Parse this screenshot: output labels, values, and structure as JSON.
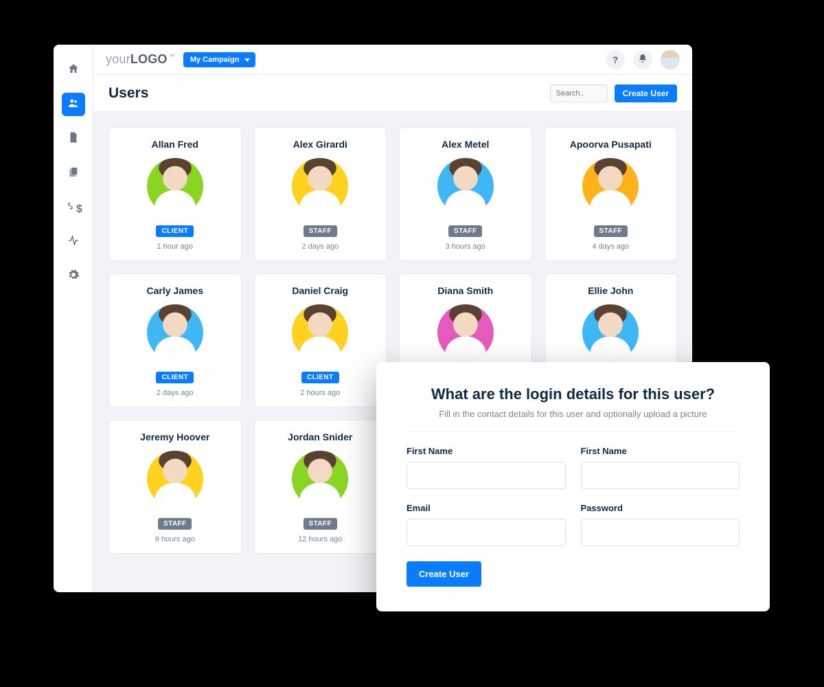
{
  "brand": {
    "prefix": "your",
    "main": "LOGO",
    "tm": "™"
  },
  "campaign_label": "My Campaign",
  "page_title": "Users",
  "search_placeholder": "Search..",
  "create_user_button": "Create User",
  "nav": {
    "home": "home",
    "users": "users",
    "report": "report",
    "files": "files",
    "billing": "billing",
    "activity": "activity",
    "settings": "settings"
  },
  "role_labels": {
    "client": "CLIENT",
    "staff": "STAFF"
  },
  "avatar_colors": {
    "green": "#8ad423",
    "yellow": "#ffd21f",
    "blue": "#3fb7f4",
    "orange": "#ffb21a",
    "pink": "#e45bbd"
  },
  "users": [
    {
      "name": "Allan Fred",
      "role": "client",
      "time": "1 hour ago",
      "color": "green"
    },
    {
      "name": "Alex Girardi",
      "role": "staff",
      "time": "2 days ago",
      "color": "yellow"
    },
    {
      "name": "Alex Metel",
      "role": "staff",
      "time": "3 hours ago",
      "color": "blue"
    },
    {
      "name": "Apoorva Pusapati",
      "role": "staff",
      "time": "4 days ago",
      "color": "orange"
    },
    {
      "name": "Carly James",
      "role": "client",
      "time": "2 days ago",
      "color": "blue"
    },
    {
      "name": "Daniel Craig",
      "role": "client",
      "time": "2 hours ago",
      "color": "yellow"
    },
    {
      "name": "Diana Smith",
      "role": "",
      "time": "",
      "color": "pink"
    },
    {
      "name": "Ellie John",
      "role": "",
      "time": "",
      "color": "blue"
    },
    {
      "name": "Jeremy Hoover",
      "role": "staff",
      "time": "9 hours ago",
      "color": "yellow"
    },
    {
      "name": "Jordan Snider",
      "role": "staff",
      "time": "12 hours ago",
      "color": "green"
    }
  ],
  "modal": {
    "title": "What are the login details for this user?",
    "subtitle": "Fill in in the contact details for this user and optionally upload a picture",
    "subtitle_actual": "Fill in the contact details for this user and optionally upload a picture",
    "fields": {
      "first_name_a": "First Name",
      "first_name_b": "First Name",
      "email": "Email",
      "password": "Password"
    },
    "submit": "Create User"
  }
}
